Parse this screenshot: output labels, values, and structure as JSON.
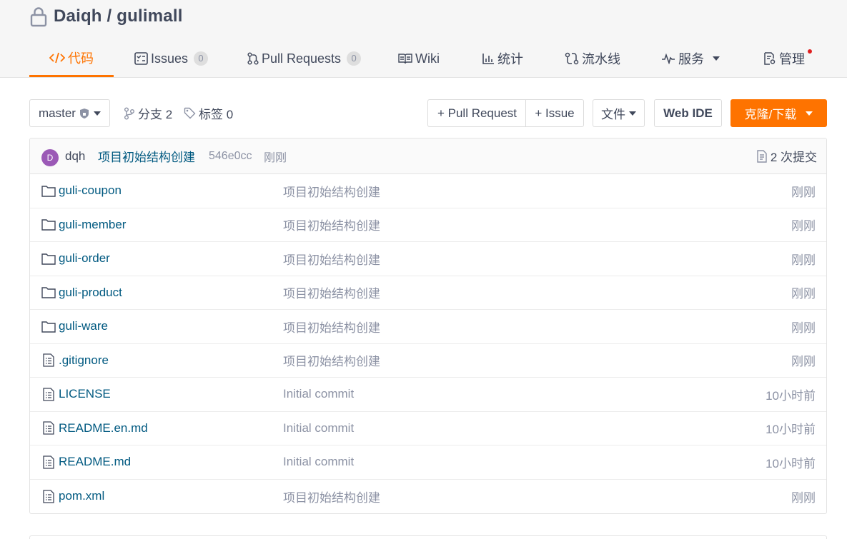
{
  "repo": {
    "owner": "Daiqh",
    "separator": " / ",
    "name": "gulimall"
  },
  "tabs": [
    {
      "label": "代码",
      "icon": "code-icon",
      "active": true
    },
    {
      "label": "Issues",
      "icon": "issues-icon",
      "badge": "0"
    },
    {
      "label": "Pull Requests",
      "icon": "pull-request-icon",
      "badge": "0"
    },
    {
      "label": "Wiki",
      "icon": "book-icon"
    },
    {
      "label": "统计",
      "icon": "bar-chart-icon"
    },
    {
      "label": "流水线",
      "icon": "pipeline-icon"
    },
    {
      "label": "服务",
      "icon": "pulse-icon",
      "dropdown": true
    },
    {
      "label": "管理",
      "icon": "settings-doc-icon",
      "notification": true
    }
  ],
  "toolbar": {
    "branch": "master",
    "branches_label": "分支 2",
    "tags_label": "标签 0",
    "pull_request_button": "+ Pull Request",
    "issue_button": "+ Issue",
    "file_button": "文件",
    "web_ide_button": "Web IDE",
    "clone_button": "克隆/下载"
  },
  "latest_commit": {
    "avatar_letter": "D",
    "author": "dqh",
    "message": "项目初始结构创建",
    "sha": "546e0cc",
    "time": "刚刚",
    "commit_count": "2 次提交"
  },
  "files": [
    {
      "type": "folder",
      "name": "guli-coupon",
      "message": "项目初始结构创建",
      "time": "刚刚"
    },
    {
      "type": "folder",
      "name": "guli-member",
      "message": "项目初始结构创建",
      "time": "刚刚"
    },
    {
      "type": "folder",
      "name": "guli-order",
      "message": "项目初始结构创建",
      "time": "刚刚"
    },
    {
      "type": "folder",
      "name": "guli-product",
      "message": "项目初始结构创建",
      "time": "刚刚"
    },
    {
      "type": "folder",
      "name": "guli-ware",
      "message": "项目初始结构创建",
      "time": "刚刚"
    },
    {
      "type": "file",
      "name": ".gitignore",
      "message": "项目初始结构创建",
      "time": "刚刚"
    },
    {
      "type": "file",
      "name": "LICENSE",
      "message": "Initial commit",
      "time": "10小时前"
    },
    {
      "type": "file",
      "name": "README.en.md",
      "message": "Initial commit",
      "time": "10小时前"
    },
    {
      "type": "file",
      "name": "README.md",
      "message": "Initial commit",
      "time": "10小时前"
    },
    {
      "type": "file",
      "name": "pom.xml",
      "message": "项目初始结构创建",
      "time": "刚刚"
    }
  ],
  "colors": {
    "accent": "#fe7300",
    "link": "#005980",
    "muted": "#8c92a4",
    "text": "#40485b"
  }
}
